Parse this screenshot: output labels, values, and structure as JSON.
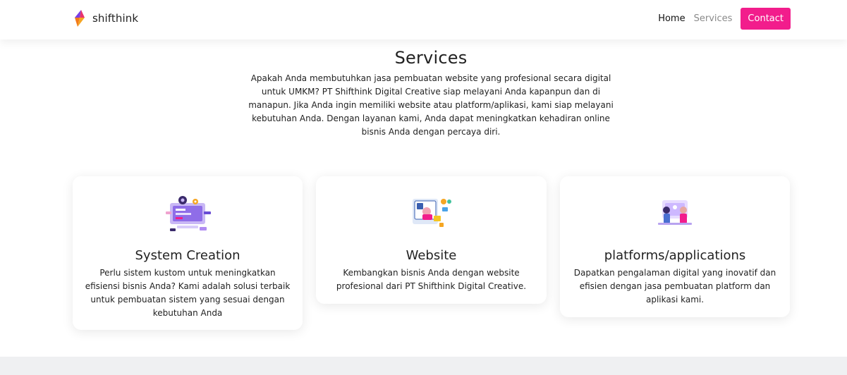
{
  "navbar": {
    "brand": "shifthink",
    "links": {
      "home": "Home",
      "services": "Services"
    },
    "contact_label": "Contact"
  },
  "intro": {
    "title": "Services",
    "text": "Apakah Anda membutuhkan jasa pembuatan website yang profesional secara digital untuk UMKM? PT Shifthink Digital Creative siap melayani Anda kapanpun dan di manapun. Jika Anda ingin memiliki website atau platform/aplikasi, kami siap melayani kebutuhan Anda. Dengan layanan kami, Anda dapat meningkatkan kehadiran online bisnis Anda dengan percaya diri."
  },
  "services": [
    {
      "icon": "system-creation-illustration",
      "title": "System Creation",
      "text": "Perlu sistem kustom untuk meningkatkan efisiensi bisnis Anda? Kami adalah solusi terbaik untuk pembuatan sistem yang sesuai dengan kebutuhan Anda"
    },
    {
      "icon": "website-illustration",
      "title": "Website",
      "text": "Kembangkan bisnis Anda dengan website profesional dari PT Shifthink Digital Creative."
    },
    {
      "icon": "platforms-illustration",
      "title": "platforms/applications",
      "text": "Dapatkan pengalaman digital yang inovatif dan efisien dengan jasa pembuatan platform dan aplikasi kami."
    }
  ],
  "colors": {
    "accent": "#f21d8c",
    "footer_band": "#eff0f2",
    "logo_top": "#7b3fe4",
    "logo_bottom": "#f5a623"
  }
}
